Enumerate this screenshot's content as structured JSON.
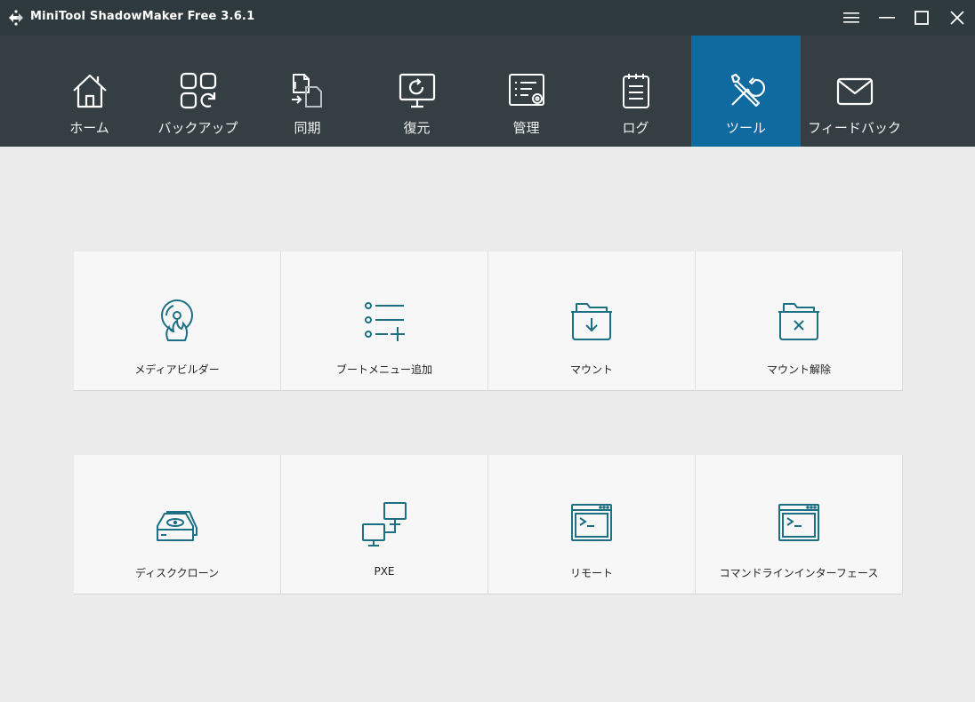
{
  "window": {
    "title": "MiniTool ShadowMaker Free 3.6.1",
    "icons": [
      "app-logo-icon",
      "menu-icon",
      "minimize-icon",
      "maximize-icon",
      "close-icon"
    ]
  },
  "nav": {
    "items": [
      {
        "label": "ホーム",
        "icon": "home-icon"
      },
      {
        "label": "バックアップ",
        "icon": "backup-icon"
      },
      {
        "label": "同期",
        "icon": "sync-icon"
      },
      {
        "label": "復元",
        "icon": "restore-icon"
      },
      {
        "label": "管理",
        "icon": "manage-icon"
      },
      {
        "label": "ログ",
        "icon": "log-icon"
      },
      {
        "label": "ツール",
        "icon": "tools-icon"
      },
      {
        "label": "フィードバック",
        "icon": "feedback-icon"
      }
    ],
    "active": "ツール"
  },
  "tools": {
    "row1": [
      {
        "label": "メディアビルダー",
        "icon": "media-builder-icon"
      },
      {
        "label": "ブートメニュー追加",
        "icon": "boot-menu-add-icon"
      },
      {
        "label": "マウント",
        "icon": "mount-icon"
      },
      {
        "label": "マウント解除",
        "icon": "unmount-icon"
      }
    ],
    "row2": [
      {
        "label": "ディスククローン",
        "icon": "disk-clone-icon"
      },
      {
        "label": "PXE",
        "icon": "pxe-icon"
      },
      {
        "label": "リモート",
        "icon": "remote-icon"
      },
      {
        "label": "コマンドラインインターフェース",
        "icon": "command-line-icon"
      }
    ]
  },
  "colors": {
    "titlebar": "#2f3a3e",
    "navbar": "#353f43",
    "active_tab": "#0f6aa0",
    "tool_icon": "#1d6f84",
    "background": "#ebebeb"
  }
}
